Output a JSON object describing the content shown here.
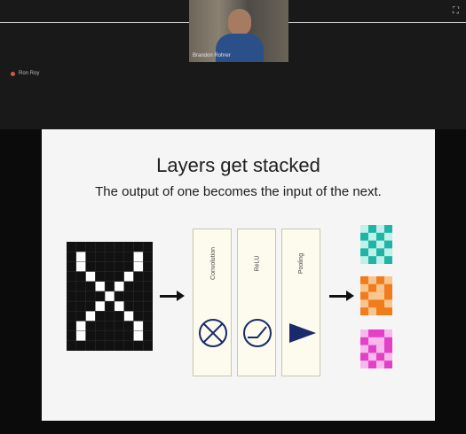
{
  "meeting": {
    "participant_name": "Brandon Rohrer",
    "self_label": "Ron Roy"
  },
  "slide": {
    "title": "Layers get stacked",
    "subtitle": "The output of one becomes the input of the next.",
    "panels": [
      {
        "label": "Convolution",
        "icon": "convolution-icon"
      },
      {
        "label": "ReLU",
        "icon": "relu-icon"
      },
      {
        "label": "Pooling",
        "icon": "pooling-icon"
      }
    ]
  },
  "colors": {
    "panel_icon": "#1a2a6c",
    "output_teal": "#1fb5a6",
    "output_orange": "#f07c1c",
    "output_magenta": "#e43fc7"
  }
}
